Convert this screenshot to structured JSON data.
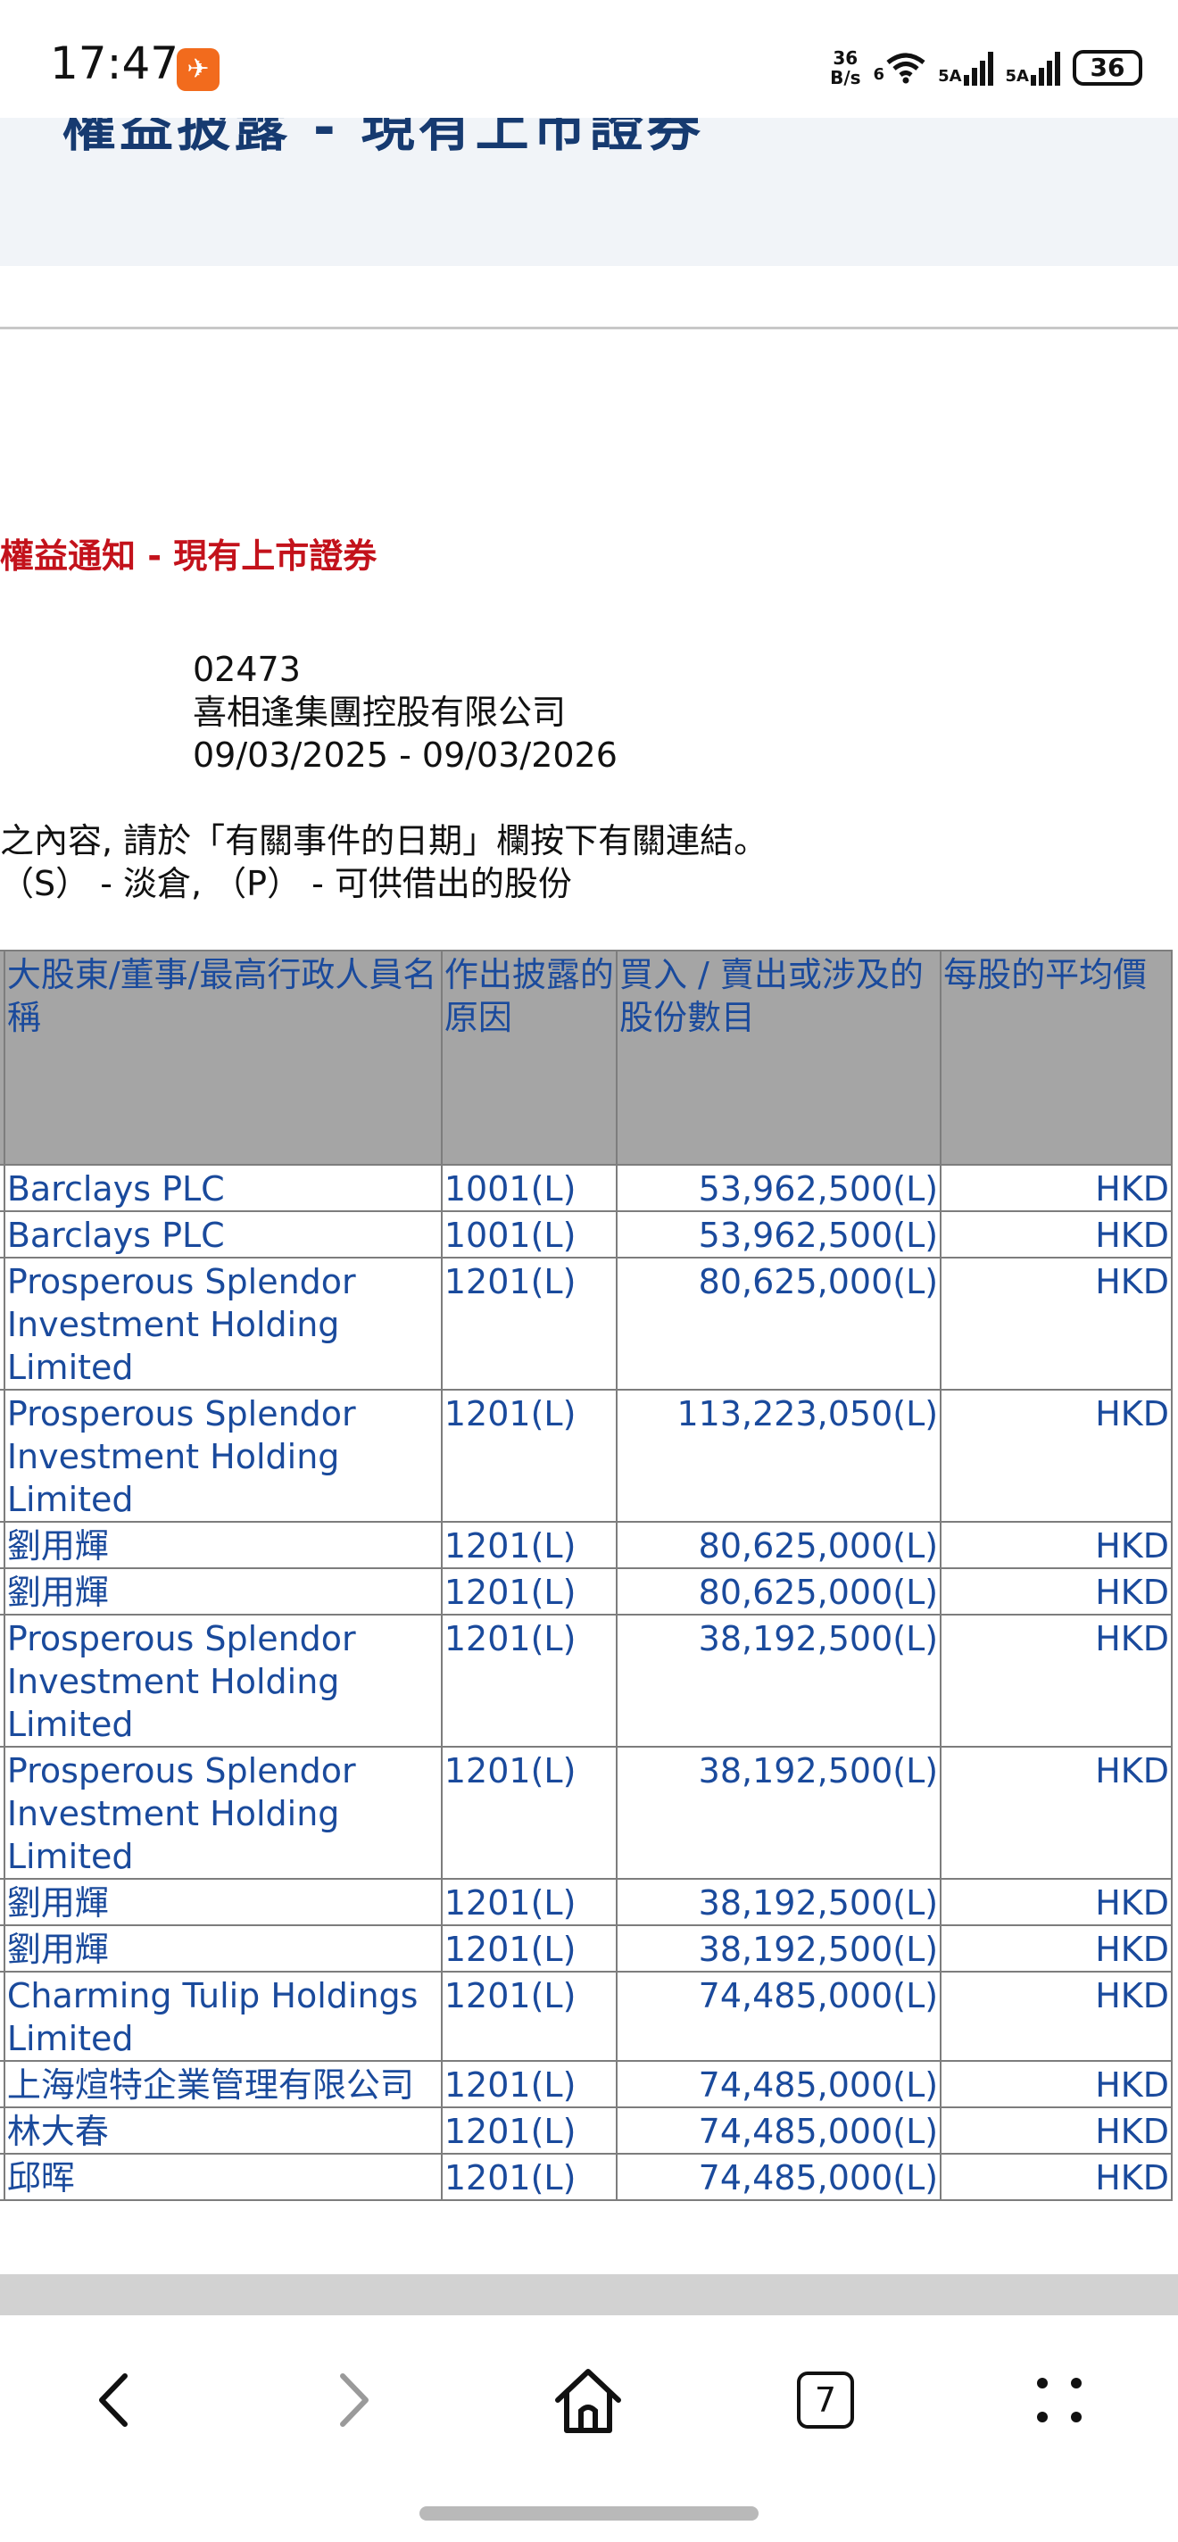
{
  "status_bar": {
    "time": "17:47",
    "net_speed_value": "36",
    "net_speed_unit": "B/s",
    "wifi_label": "6",
    "sim1_label": "5A",
    "sim2_label": "5A",
    "battery": "36"
  },
  "page": {
    "banner_title": "權益披露 - 現有上市證券",
    "notice_heading": "權益通知 - 現有上市證券",
    "stock_code": "02473",
    "company_name": "喜相逢集團控股有限公司",
    "date_range": "09/03/2025 - 09/03/2026",
    "note_line1": "之內容, 請於「有關事件的日期」欄按下有關連結。",
    "note_line2": "（S） - 淡倉, （P） - 可供借出的股份"
  },
  "table": {
    "headers": {
      "name": "大股東/董事/最高行政人員名稱",
      "reason": "作出披露的原因",
      "shares": "買入 / 賣出或涉及的股份數目",
      "avg_price": "每股的平均價"
    },
    "rows": [
      {
        "name": "Barclays PLC",
        "reason": "1001(L)",
        "shares": "53,962,500(L)",
        "currency": "HKD"
      },
      {
        "name": "Barclays PLC",
        "reason": "1001(L)",
        "shares": "53,962,500(L)",
        "currency": "HKD"
      },
      {
        "name": "Prosperous Splendor Investment Holding Limited",
        "reason": "1201(L)",
        "shares": "80,625,000(L)",
        "currency": "HKD"
      },
      {
        "name": "Prosperous Splendor Investment Holding Limited",
        "reason": "1201(L)",
        "shares": "113,223,050(L)",
        "currency": "HKD"
      },
      {
        "name": "劉用輝",
        "reason": "1201(L)",
        "shares": "80,625,000(L)",
        "currency": "HKD"
      },
      {
        "name": "劉用輝",
        "reason": "1201(L)",
        "shares": "80,625,000(L)",
        "currency": "HKD"
      },
      {
        "name": "Prosperous Splendor Investment Holding Limited",
        "reason": "1201(L)",
        "shares": "38,192,500(L)",
        "currency": "HKD"
      },
      {
        "name": "Prosperous Splendor Investment Holding Limited",
        "reason": "1201(L)",
        "shares": "38,192,500(L)",
        "currency": "HKD"
      },
      {
        "name": "劉用輝",
        "reason": "1201(L)",
        "shares": "38,192,500(L)",
        "currency": "HKD"
      },
      {
        "name": "劉用輝",
        "reason": "1201(L)",
        "shares": "38,192,500(L)",
        "currency": "HKD"
      },
      {
        "name": "Charming Tulip Holdings Limited",
        "reason": "1201(L)",
        "shares": "74,485,000(L)",
        "currency": "HKD"
      },
      {
        "name": "上海煊特企業管理有限公司",
        "reason": "1201(L)",
        "shares": "74,485,000(L)",
        "currency": "HKD"
      },
      {
        "name": "林大春",
        "reason": "1201(L)",
        "shares": "74,485,000(L)",
        "currency": "HKD"
      },
      {
        "name": "邱晖",
        "reason": "1201(L)",
        "shares": "74,485,000(L)",
        "currency": "HKD"
      }
    ]
  },
  "nav": {
    "tab_count": "7"
  },
  "icons": [
    "wifi-icon",
    "signal-icon",
    "battery-icon",
    "back-icon",
    "forward-icon",
    "home-icon",
    "tabs-icon",
    "menu-icon"
  ]
}
